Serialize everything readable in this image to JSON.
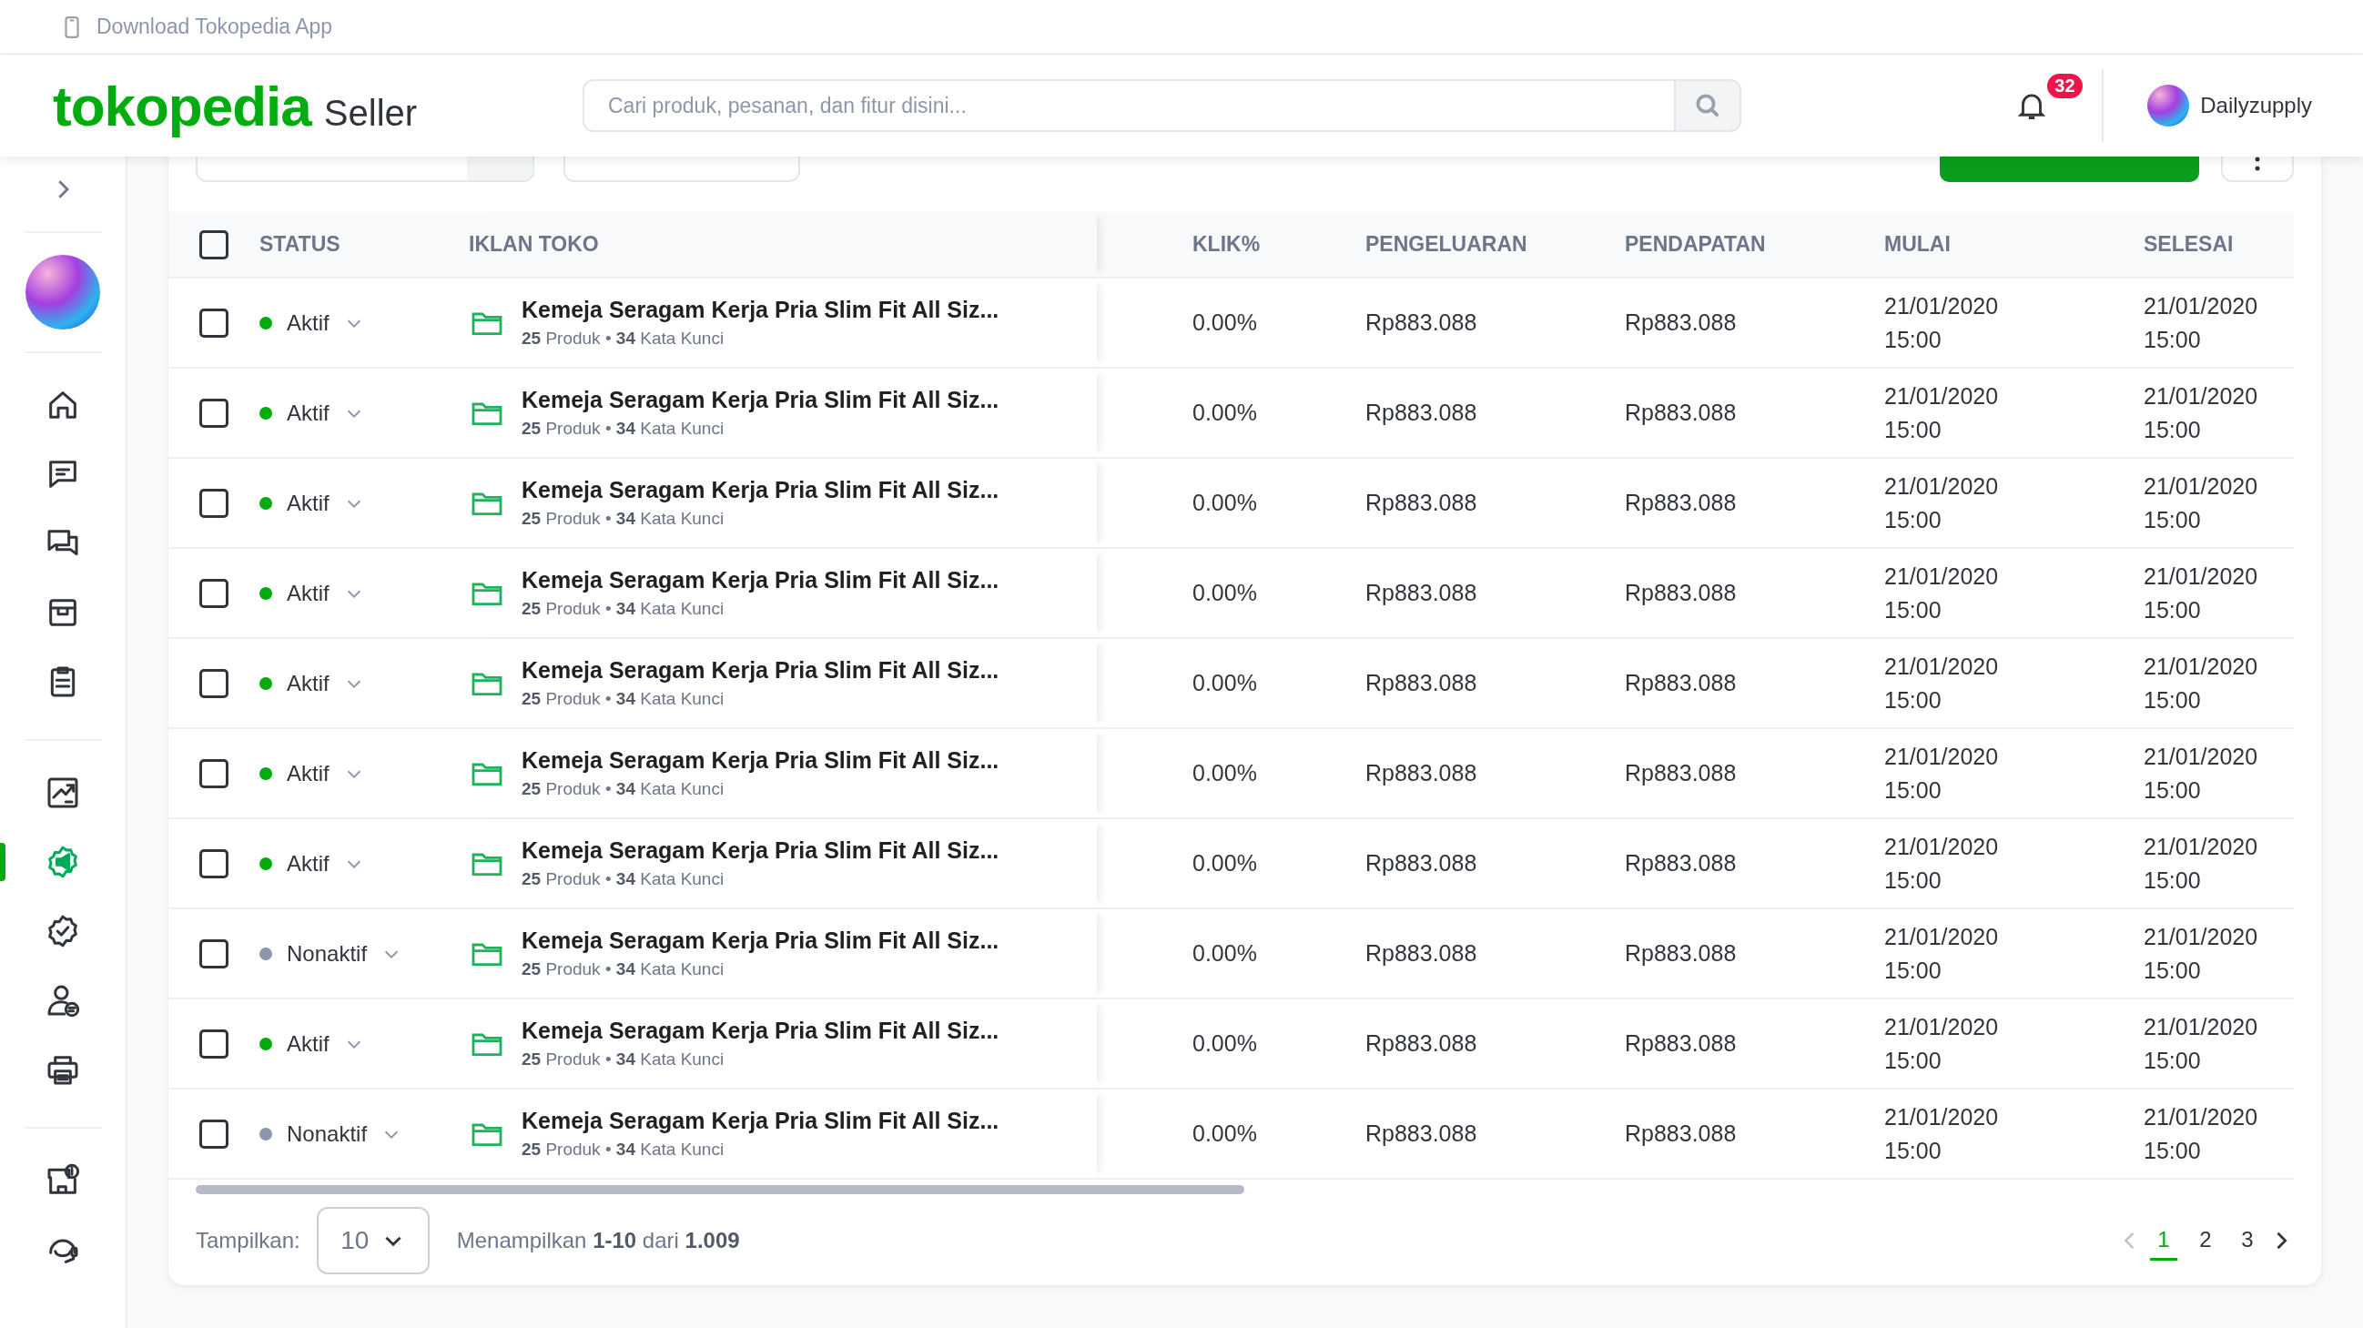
{
  "top_bar": {
    "text": "Download Tokopedia App"
  },
  "header": {
    "logo": "tokopedia",
    "product": "Seller",
    "search_placeholder": "Cari produk, pesanan, dan fitur disini...",
    "notification_count": "32",
    "user_name": "Dailyzupply"
  },
  "sidebar": {
    "groups": [
      {
        "items": [
          {
            "kind": "home",
            "selected": false
          },
          {
            "kind": "chat",
            "selected": false
          },
          {
            "kind": "discussion",
            "selected": false
          },
          {
            "kind": "product",
            "selected": false
          },
          {
            "kind": "order",
            "selected": false
          }
        ]
      },
      {
        "items": [
          {
            "kind": "stats",
            "selected": false
          },
          {
            "kind": "ads",
            "selected": true
          },
          {
            "kind": "badge",
            "selected": false
          },
          {
            "kind": "customer",
            "selected": false
          },
          {
            "kind": "printer",
            "selected": false
          }
        ]
      },
      {
        "items": [
          {
            "kind": "shop-info",
            "selected": false
          },
          {
            "kind": "help",
            "selected": false
          }
        ]
      }
    ]
  },
  "table": {
    "select_all_checked": false,
    "columns": [
      "STATUS",
      "IKLAN TOKO",
      "KLIK%",
      "PENGELUARAN",
      "PENDAPATAN",
      "MULAI",
      "SELESAI"
    ],
    "rows": [
      {
        "checked": false,
        "status": {
          "label": "Aktif",
          "active": true
        },
        "title": "Kemeja Seragam Kerja Pria Slim Fit All Siz...",
        "meta": "**25** Produk • **34** Kata Kunci",
        "klik": "0.00%",
        "pengeluaran": "Rp883.088",
        "pendapatan": "Rp883.088",
        "mulai": "21/01/2020 15:00",
        "selesai": "21/01/2020 15:00"
      },
      {
        "checked": false,
        "status": {
          "label": "Aktif",
          "active": true
        },
        "title": "Kemeja Seragam Kerja Pria Slim Fit All Siz...",
        "meta": "**25** Produk • **34** Kata Kunci",
        "klik": "0.00%",
        "pengeluaran": "Rp883.088",
        "pendapatan": "Rp883.088",
        "mulai": "21/01/2020 15:00",
        "selesai": "21/01/2020 15:00"
      },
      {
        "checked": false,
        "status": {
          "label": "Aktif",
          "active": true
        },
        "title": "Kemeja Seragam Kerja Pria Slim Fit All Siz...",
        "meta": "**25** Produk • **34** Kata Kunci",
        "klik": "0.00%",
        "pengeluaran": "Rp883.088",
        "pendapatan": "Rp883.088",
        "mulai": "21/01/2020 15:00",
        "selesai": "21/01/2020 15:00"
      },
      {
        "checked": false,
        "status": {
          "label": "Aktif",
          "active": true
        },
        "title": "Kemeja Seragam Kerja Pria Slim Fit All Siz...",
        "meta": "**25** Produk • **34** Kata Kunci",
        "klik": "0.00%",
        "pengeluaran": "Rp883.088",
        "pendapatan": "Rp883.088",
        "mulai": "21/01/2020 15:00",
        "selesai": "21/01/2020 15:00"
      },
      {
        "checked": false,
        "status": {
          "label": "Aktif",
          "active": true
        },
        "title": "Kemeja Seragam Kerja Pria Slim Fit All Siz...",
        "meta": "**25** Produk • **34** Kata Kunci",
        "klik": "0.00%",
        "pengeluaran": "Rp883.088",
        "pendapatan": "Rp883.088",
        "mulai": "21/01/2020 15:00",
        "selesai": "21/01/2020 15:00"
      },
      {
        "checked": false,
        "status": {
          "label": "Aktif",
          "active": true
        },
        "title": "Kemeja Seragam Kerja Pria Slim Fit All Siz...",
        "meta": "**25** Produk • **34** Kata Kunci",
        "klik": "0.00%",
        "pengeluaran": "Rp883.088",
        "pendapatan": "Rp883.088",
        "mulai": "21/01/2020 15:00",
        "selesai": "21/01/2020 15:00"
      },
      {
        "checked": false,
        "status": {
          "label": "Aktif",
          "active": true
        },
        "title": "Kemeja Seragam Kerja Pria Slim Fit All Siz...",
        "meta": "**25** Produk • **34** Kata Kunci",
        "klik": "0.00%",
        "pengeluaran": "Rp883.088",
        "pendapatan": "Rp883.088",
        "mulai": "21/01/2020 15:00",
        "selesai": "21/01/2020 15:00"
      },
      {
        "checked": false,
        "status": {
          "label": "Nonaktif",
          "active": false
        },
        "title": "Kemeja Seragam Kerja Pria Slim Fit All Siz...",
        "meta": "**25** Produk • **34** Kata Kunci",
        "klik": "0.00%",
        "pengeluaran": "Rp883.088",
        "pendapatan": "Rp883.088",
        "mulai": "21/01/2020 15:00",
        "selesai": "21/01/2020 15:00"
      },
      {
        "checked": false,
        "status": {
          "label": "Aktif",
          "active": true
        },
        "title": "Kemeja Seragam Kerja Pria Slim Fit All Siz...",
        "meta": "**25** Produk • **34** Kata Kunci",
        "klik": "0.00%",
        "pengeluaran": "Rp883.088",
        "pendapatan": "Rp883.088",
        "mulai": "21/01/2020 15:00",
        "selesai": "21/01/2020 15:00"
      },
      {
        "checked": false,
        "status": {
          "label": "Nonaktif",
          "active": false
        },
        "title": "Kemeja Seragam Kerja Pria Slim Fit All Siz...",
        "meta": "**25** Produk • **34** Kata Kunci",
        "klik": "0.00%",
        "pengeluaran": "Rp883.088",
        "pendapatan": "Rp883.088",
        "mulai": "21/01/2020 15:00",
        "selesai": "21/01/2020 15:00"
      }
    ]
  },
  "footer": {
    "page_size_label": "Tampilkan:",
    "page_size": "10",
    "summary": "Menampilkan **1-10** dari **1.009**",
    "pages": [
      {
        "label": "1",
        "selected": true
      },
      {
        "label": "2",
        "selected": false
      },
      {
        "label": "3",
        "selected": false
      }
    ]
  }
}
